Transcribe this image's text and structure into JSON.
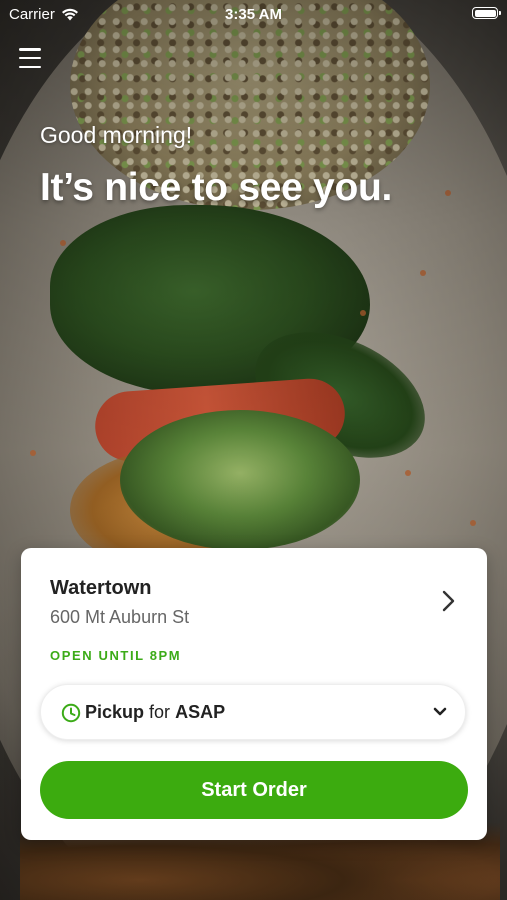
{
  "status_bar": {
    "carrier": "Carrier",
    "time": "3:35 AM"
  },
  "header": {
    "greeting": "Good morning!",
    "headline": "It’s nice to see you."
  },
  "location_card": {
    "name": "Watertown",
    "address": "600 Mt Auburn St",
    "open_status": "OPEN UNTIL 8PM",
    "order_mode": {
      "mode": "Pickup",
      "connector": "for",
      "time": "ASAP"
    },
    "start_button_label": "Start Order"
  },
  "icons": [
    "menu-icon",
    "wifi-icon",
    "battery-icon",
    "chevron-right-icon",
    "clock-icon",
    "chevron-down-icon"
  ],
  "colors": {
    "accent_green": "#3cab0f",
    "open_status_green": "#3cab18",
    "card_background": "#ffffff"
  }
}
